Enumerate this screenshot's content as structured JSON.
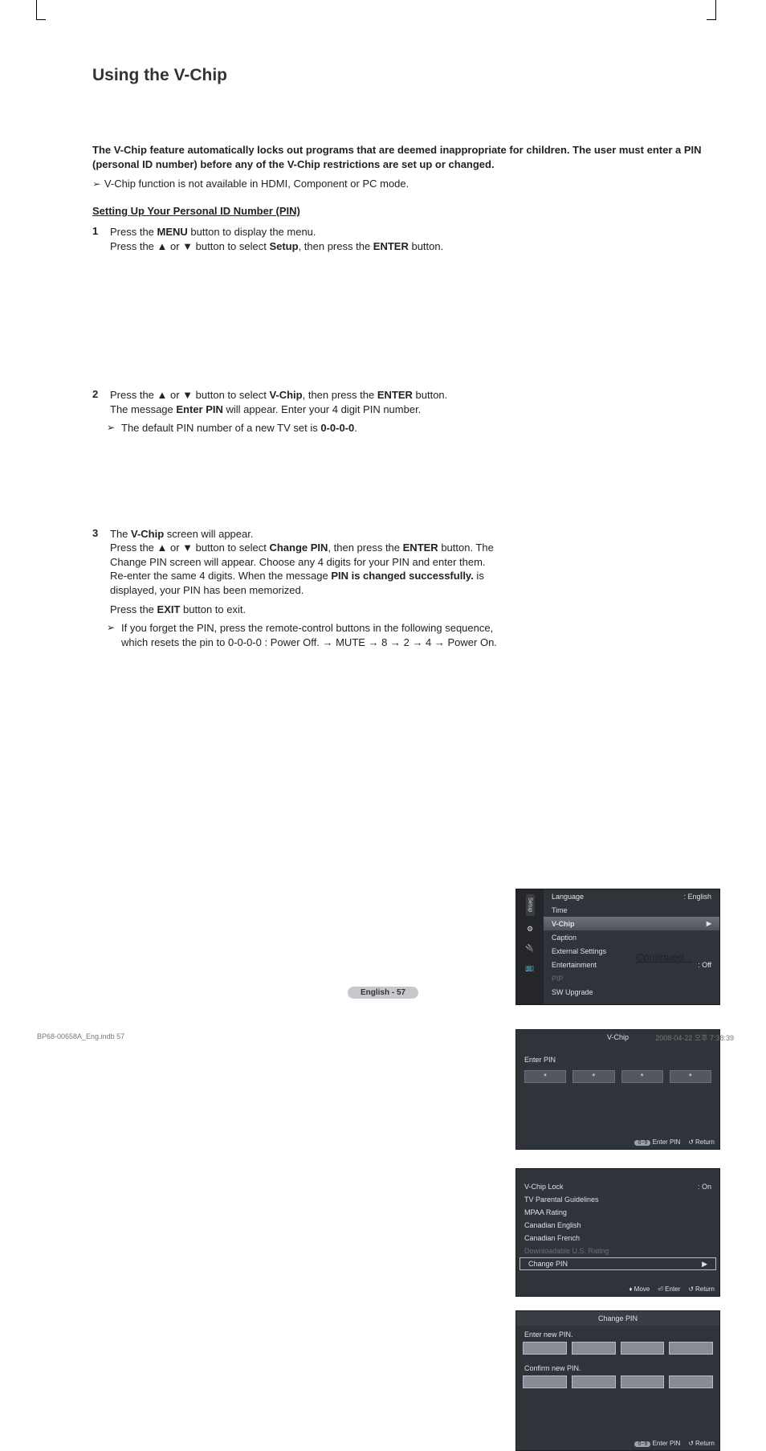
{
  "page": {
    "title": "Using the V-Chip",
    "intro": "The V-Chip feature automatically locks out programs that are deemed inappropriate for children. The user must enter a PIN (personal ID number) before any of the V-Chip restrictions are set up or changed.",
    "top_note": "V-Chip function is not available in HDMI, Component or PC mode.",
    "section_sub": "Setting Up Your Personal ID Number (PIN)",
    "continued": "Continued...",
    "page_pill": "English - 57",
    "footer_left": "BP68-00658A_Eng.indb   57",
    "footer_right": "2008-04-22   오후 7:38:39"
  },
  "steps": {
    "s1": {
      "num": "1",
      "l1a": "Press the ",
      "l1b": "MENU",
      "l1c": " button to display the menu.",
      "l2a": "Press the ▲ or ▼ button to select ",
      "l2b": "Setup",
      "l2c": ", then press the ",
      "l2d": "ENTER",
      "l2e": " button."
    },
    "s2": {
      "num": "2",
      "l1a": "Press the ▲ or ▼ button to select ",
      "l1b": "V-Chip",
      "l1c": ", then press the ",
      "l1d": "ENTER",
      "l1e": " button.",
      "l2a": "The message ",
      "l2b": "Enter PIN",
      "l2c": " will appear. Enter your 4 digit PIN number.",
      "n1a": "The default PIN number of a new TV set is ",
      "n1b": "0-0-0-0",
      "n1c": "."
    },
    "s3": {
      "num": "3",
      "l1a": "The ",
      "l1b": "V-Chip",
      "l1c": " screen will appear.",
      "l2a": "Press the ▲ or ▼ button to select ",
      "l2b": "Change PIN",
      "l2c": ", then press the ",
      "l2d": "ENTER",
      "l2e": " button. The Change PIN screen will appear. Choose any 4 digits for your PIN and enter them. Re-enter the same 4 digits. When the message ",
      "l2f": "PIN is changed successfully.",
      "l2g": " is displayed, your PIN has been memorized.",
      "l3a": "Press the ",
      "l3b": "EXIT",
      "l3c": " button to exit.",
      "n1": "If you forget the PIN, press the remote-control buttons in the following sequence, which resets the pin to 0-0-0-0 : Power Off. → MUTE → 8 → 2 → 4 → Power On."
    }
  },
  "osd1": {
    "side_label": "Setup",
    "r1": {
      "label": "Language",
      "value": ": English"
    },
    "r2": {
      "label": "Time",
      "value": ""
    },
    "r3": {
      "label": "V-Chip",
      "arrow": "▶"
    },
    "r4": {
      "label": "Caption",
      "value": ""
    },
    "r5": {
      "label": "External Settings",
      "value": ""
    },
    "r6": {
      "label": "Entertainment",
      "value": ": Off"
    },
    "r7": {
      "label": "PIP",
      "value": ""
    },
    "r8": {
      "label": "SW Upgrade",
      "value": ""
    }
  },
  "osd2": {
    "title": "V-Chip",
    "label": "Enter PIN",
    "star": "*",
    "hint_pill": "0~9",
    "hint1": "Enter PIN",
    "hint2": "Return"
  },
  "osd3": {
    "r1": {
      "label": "V-Chip Lock",
      "value": ": On"
    },
    "r2": {
      "label": "TV Parental Guidelines"
    },
    "r3": {
      "label": "MPAA Rating"
    },
    "r4": {
      "label": "Canadian English"
    },
    "r5": {
      "label": "Canadian French"
    },
    "r6": {
      "label": "Downloadable U.S. Rating"
    },
    "r7": {
      "label": "Change PIN",
      "arrow": "▶"
    },
    "h1": "Move",
    "h2": "Enter",
    "h3": "Return"
  },
  "osd4": {
    "title": "Change PIN",
    "l1": "Enter new PIN.",
    "l2": "Confirm new PIN.",
    "hint_pill": "0~9",
    "hint1": "Enter PIN",
    "hint2": "Return"
  }
}
